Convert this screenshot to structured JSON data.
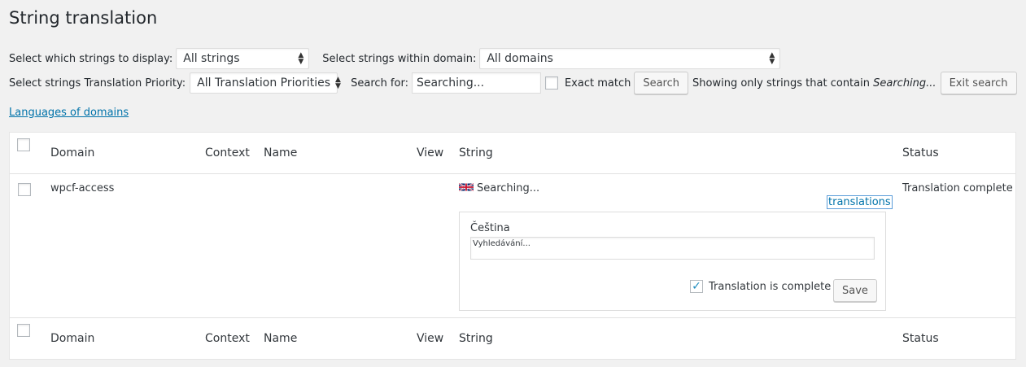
{
  "page": {
    "title": "String translation"
  },
  "filters": {
    "display_label": "Select which strings to display:",
    "display_value": "All strings",
    "domain_label": "Select strings within domain:",
    "domain_value": "All domains",
    "priority_label": "Select strings Translation Priority:",
    "priority_value": "All Translation Priorities",
    "search_label": "Search for:",
    "search_value": "Searching...",
    "exact_match_label": "Exact match",
    "search_button": "Search",
    "showing_prefix": "Showing only strings that contain",
    "showing_term": "Searching...",
    "exit_search_button": "Exit search"
  },
  "languages_link": "Languages of domains",
  "table": {
    "columns": {
      "domain": "Domain",
      "context": "Context",
      "name": "Name",
      "view": "View",
      "string": "String",
      "status": "Status"
    },
    "rows": [
      {
        "domain": "wpcf-access",
        "context": "",
        "name": "",
        "view": "",
        "string": "Searching...",
        "translations_link": "translations",
        "status": "Translation complete",
        "translation": {
          "language": "Čeština",
          "value": "Vyhledávání...",
          "complete_label": "Translation is complete",
          "complete_checked": true,
          "save_button": "Save"
        }
      }
    ]
  },
  "icons": {
    "flag": "uk-flag-icon",
    "select_arrows": "up-down-arrows-icon",
    "check": "checkmark-icon"
  },
  "colors": {
    "link": "#0073aa",
    "check": "#1e8cbe",
    "background": "#f1f1f1"
  }
}
